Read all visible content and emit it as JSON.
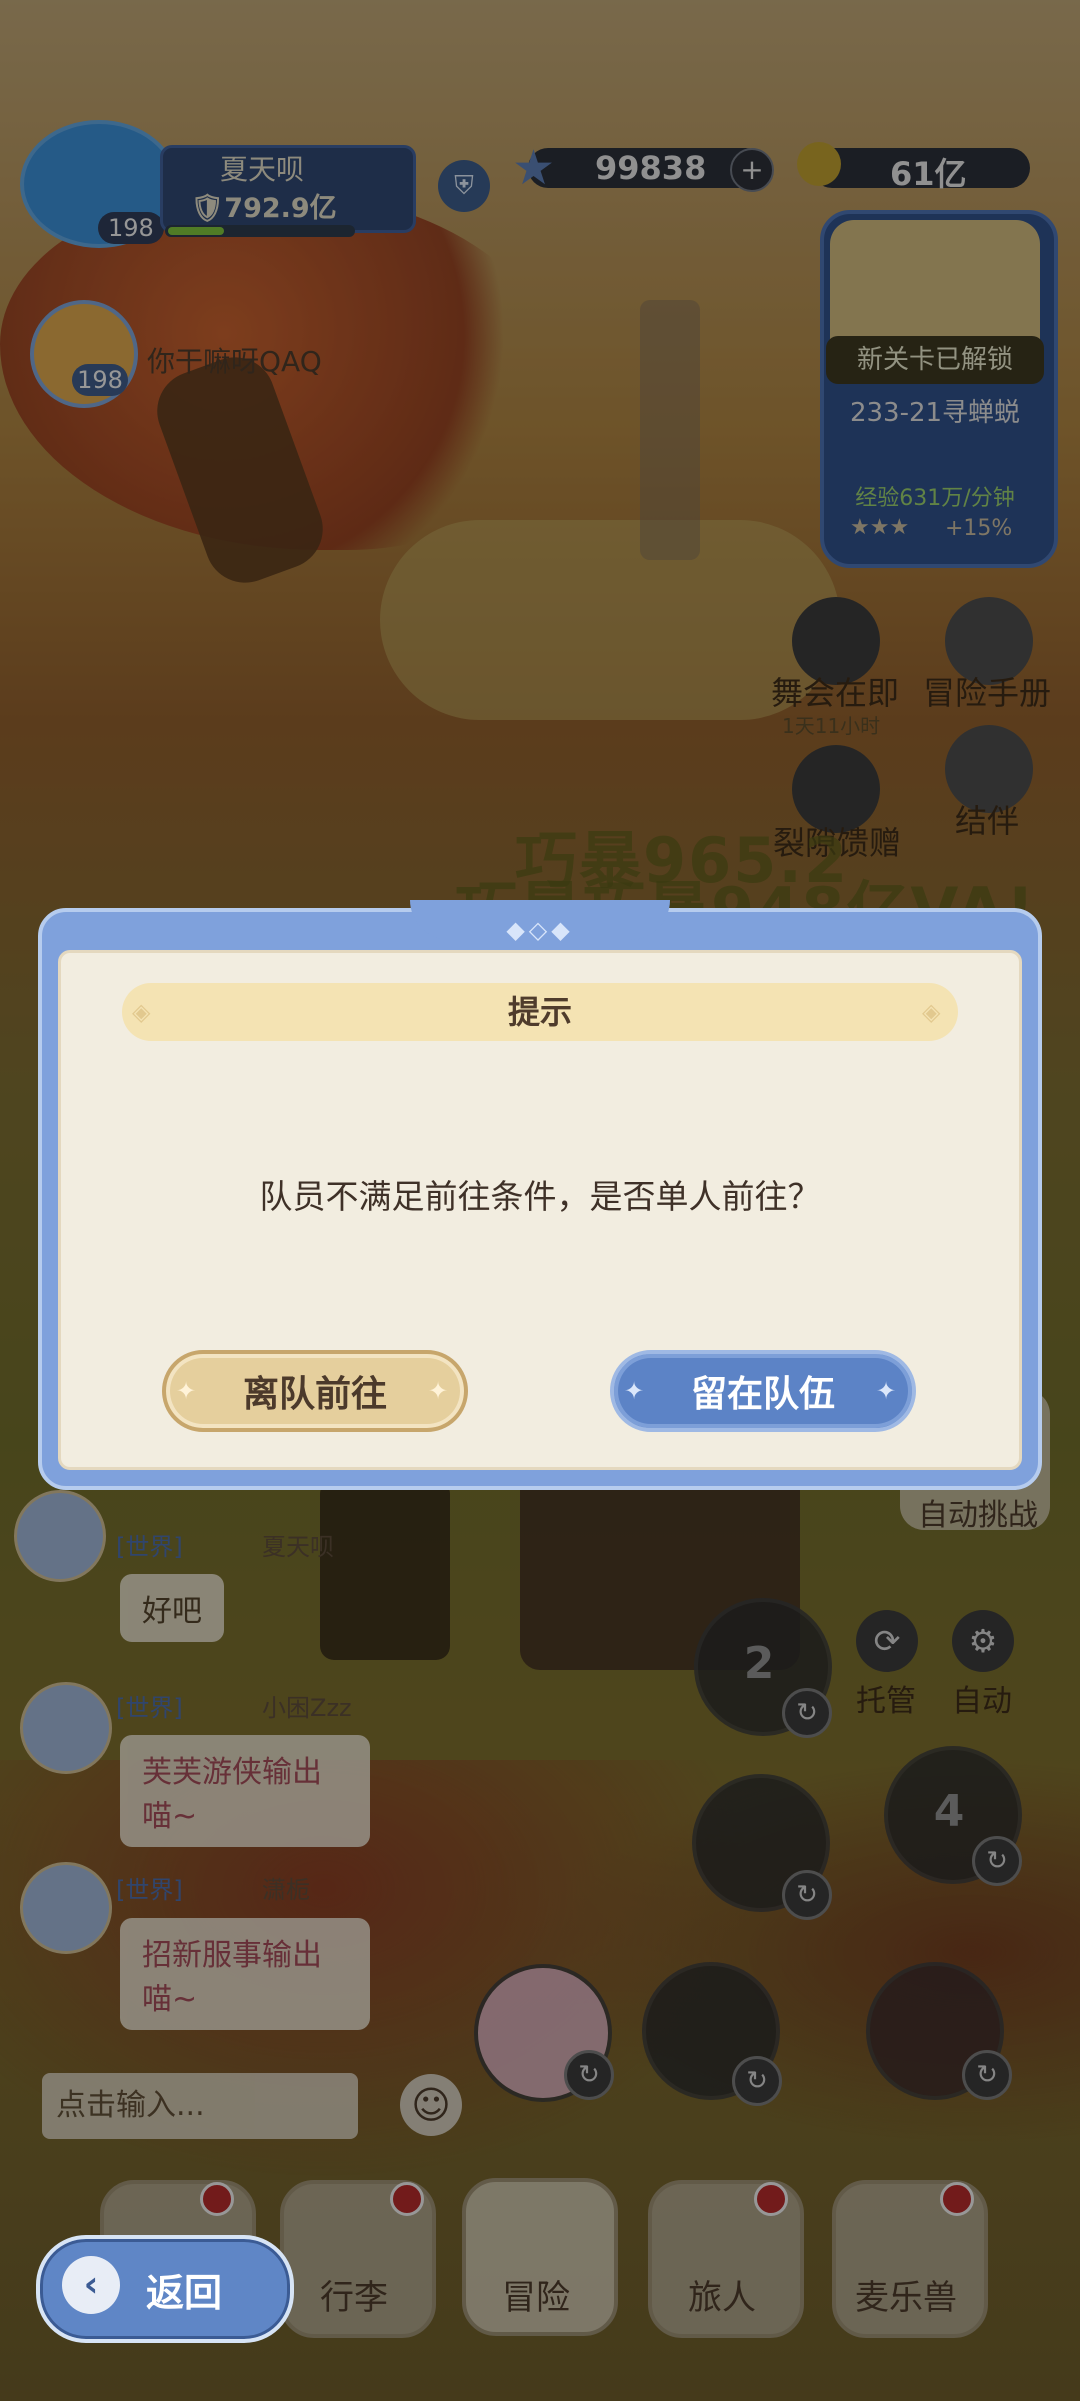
{
  "player": {
    "name": "夏天呗",
    "power": "792.9亿",
    "level": "198",
    "exp_fraction": 0.3
  },
  "currency": {
    "stars": "99838",
    "gold": "61亿"
  },
  "friend": {
    "name": "你干嘛呀QAQ",
    "level": "198"
  },
  "stage_card": {
    "unlock_label": "新关卡已解锁",
    "stage_name": "233-21寻蝉蜕",
    "exp_rate": "经验631万/分钟",
    "stars": "★★★",
    "bonus": "+15%"
  },
  "side_menu": {
    "dance": "舞会在即",
    "dance_timer": "1天11小时",
    "handbook": "冒险手册",
    "rift_gift": "裂隙馈赠",
    "partner": "结伴"
  },
  "floating_damage": {
    "line1": "巧暴965.2",
    "line2": "巧暴巧暴948亿VA!"
  },
  "dialog": {
    "title": "提示",
    "message": "队员不满足前往条件，是否单人前往？",
    "leave_button": "离队前往",
    "stay_button": "留在队伍"
  },
  "auto_battle_label": "自动挑战",
  "chat": {
    "messages": [
      {
        "channel": "[世界]",
        "user": "夏天呗",
        "text": "好吧"
      },
      {
        "channel": "[世界]",
        "user": "小困Zzz",
        "text": "芙芙游侠输出喵~"
      },
      {
        "channel": "[世界]",
        "user": "潇栀",
        "text": "招新服事输出喵~"
      }
    ],
    "input_placeholder": "点击输入..."
  },
  "controls": {
    "hosting": "托管",
    "auto": "自动",
    "skill2": "2",
    "skill4": "4"
  },
  "nav": {
    "back": "返回",
    "tabs": [
      "行李",
      "冒险",
      "旅人",
      "麦乐兽"
    ]
  },
  "colors": {
    "dialog_frame": "#7fa1dc",
    "dialog_body": "#f2ede0",
    "leave_button": "#e5cf9d",
    "stay_button": "#5c83c6"
  }
}
